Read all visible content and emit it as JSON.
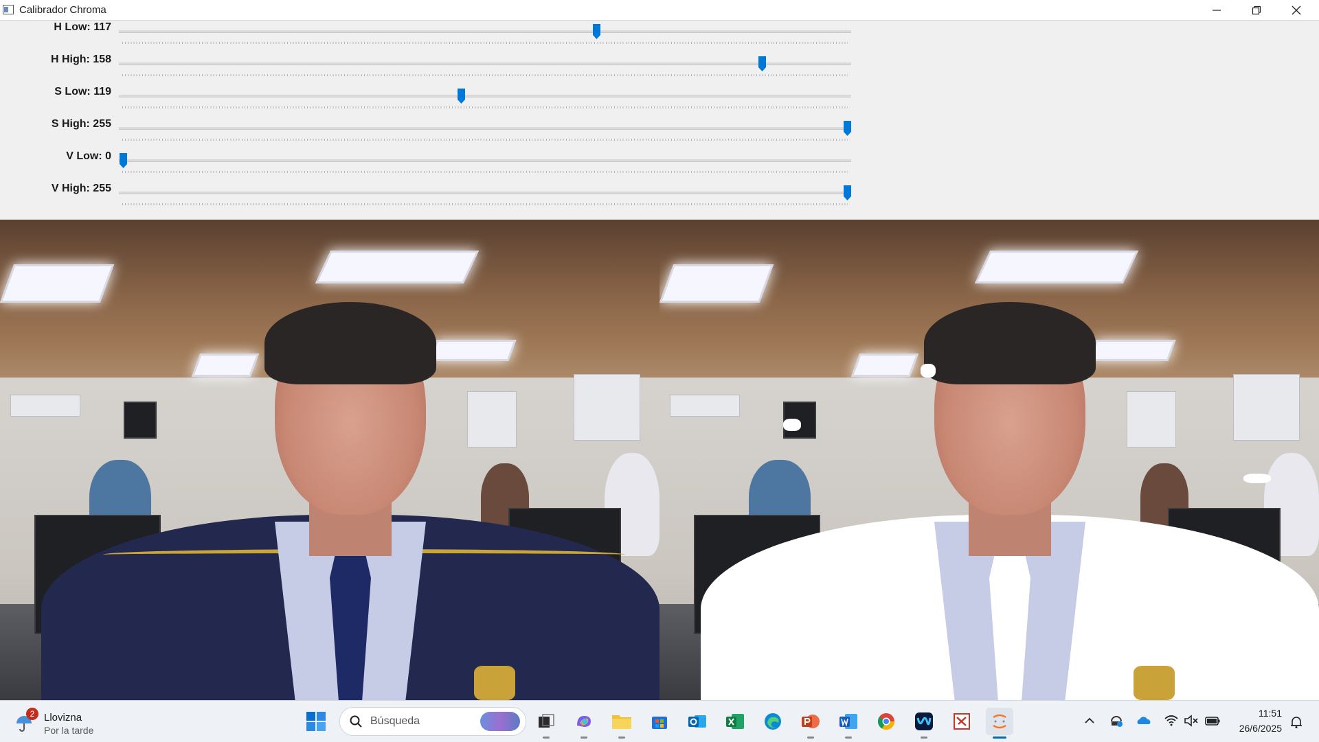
{
  "window": {
    "title": "Calibrador Chroma",
    "controls": {
      "minimize": "minimize-icon",
      "maximize": "restore-icon",
      "close": "close-icon"
    }
  },
  "trackbars": [
    {
      "label": "H Low: 117",
      "value": 117,
      "max": 179
    },
    {
      "label": "H High: 158",
      "value": 158,
      "max": 179
    },
    {
      "label": "S Low: 119",
      "value": 119,
      "max": 255
    },
    {
      "label": "S High: 255",
      "value": 255,
      "max": 255
    },
    {
      "label": "V Low: 0",
      "value": 0,
      "max": 255
    },
    {
      "label": "V High: 255",
      "value": 255,
      "max": 255
    }
  ],
  "views": {
    "left": "original-camera-feed",
    "right": "chroma-mask-result"
  },
  "taskbar": {
    "weather": {
      "badge": "2",
      "condition": "Llovizna",
      "period": "Por la tarde",
      "icon": "rain-umbrella-icon"
    },
    "search_placeholder": "Búsqueda",
    "apps": [
      "windows-start-icon",
      "task-view-icon",
      "copilot-icon",
      "file-explorer-icon",
      "microsoft-store-icon",
      "outlook-icon",
      "excel-icon",
      "edge-icon",
      "powerpoint-icon",
      "word-icon",
      "chrome-icon",
      "webex-icon",
      "app-red-icon",
      "python-app-icon"
    ],
    "tray": [
      "chevron-up-icon",
      "security-icon",
      "onedrive-icon",
      "wifi-icon",
      "mute-icon",
      "battery-icon"
    ],
    "time": "11:51",
    "date": "26/6/2025"
  },
  "colors": {
    "accent": "#0067c0",
    "thumb": "#0078d7",
    "mask": "#ffffff"
  }
}
